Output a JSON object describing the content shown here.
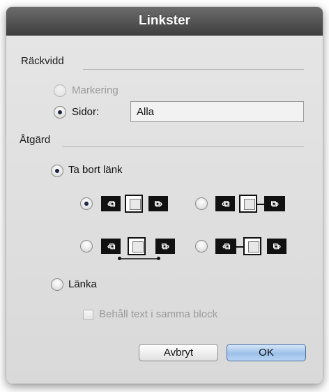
{
  "dialog": {
    "title": "Linkster",
    "scope": {
      "heading": "Räckvidd",
      "selection_label": "Markering",
      "pages_label": "Sidor:",
      "pages_value": "Alla"
    },
    "action": {
      "heading": "Åtgärd",
      "remove_link_label": "Ta bort länk",
      "link_label": "Länka",
      "keep_text_label": "Behåll text i samma block"
    },
    "buttons": {
      "cancel": "Avbryt",
      "ok": "OK"
    }
  }
}
